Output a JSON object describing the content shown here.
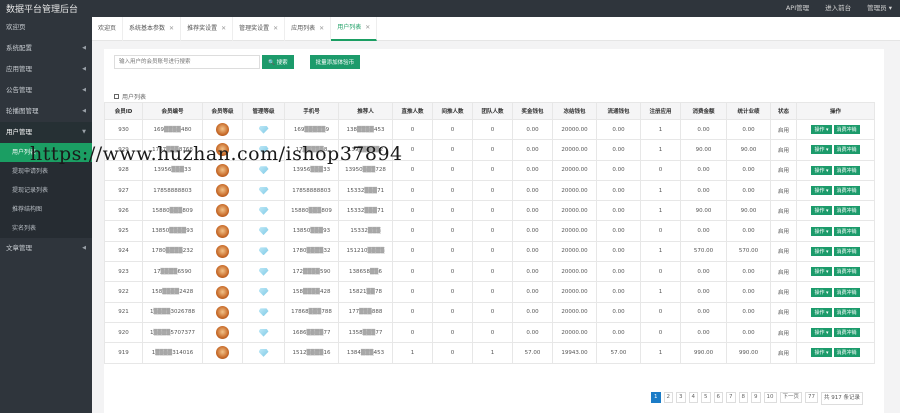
{
  "topbar": {
    "title": "数据平台管理后台",
    "nav": [
      "API管理",
      "进入前台",
      "管理员 ▾"
    ]
  },
  "sidebar": {
    "items": [
      {
        "label": "欢迎页",
        "arrow": ""
      },
      {
        "label": "系统配置",
        "arrow": "◀"
      },
      {
        "label": "应用管理",
        "arrow": "◀"
      },
      {
        "label": "公告管理",
        "arrow": "◀"
      },
      {
        "label": "轮播图管理",
        "arrow": "◀"
      },
      {
        "label": "用户管理",
        "arrow": "▼"
      }
    ],
    "sub_items": [
      "用户列表",
      "提现申请列表",
      "提现记录列表",
      "推荐结构图",
      "实名列表"
    ],
    "after_items": [
      {
        "label": "文章管理",
        "arrow": "◀"
      }
    ]
  },
  "tabs": [
    {
      "label": "欢迎页",
      "closable": false
    },
    {
      "label": "系统基本参数",
      "closable": true
    },
    {
      "label": "推荐奖设置",
      "closable": true
    },
    {
      "label": "管理奖设置",
      "closable": true
    },
    {
      "label": "应用列表",
      "closable": true
    },
    {
      "label": "用户列表",
      "closable": true
    }
  ],
  "search": {
    "placeholder": "输入用户的会员账号进行搜索",
    "button_label": "🔍 搜索",
    "batch_label": "批量添加体验币"
  },
  "list_title": "用户列表",
  "table": {
    "headers": [
      "会员ID",
      "会员编号",
      "会员等级",
      "管理等级",
      "手机号",
      "推荐人",
      "直推人数",
      "间推人数",
      "团队人数",
      "奖金钱包",
      "冻结钱包",
      "流通钱包",
      "注册应用",
      "消费金额",
      "统计业绩",
      "状态",
      "操作"
    ],
    "rows": [
      [
        "930",
        "169▒▒▒▒480",
        "",
        "",
        "169▒▒▒▒▒9",
        "138▒▒▒▒453",
        "0",
        "0",
        "0",
        "0.00",
        "20000.00",
        "0.00",
        "1",
        "0.00",
        "0.00",
        "启用"
      ],
      [
        "929",
        "1767▒▒▒8768",
        "",
        "",
        "17▒▒▒▒▒8",
        "139▒▒▒▒▒2",
        "0",
        "0",
        "0",
        "0.00",
        "20000.00",
        "0.00",
        "1",
        "90.00",
        "90.00",
        "启用"
      ],
      [
        "928",
        "13956▒▒▒33",
        "",
        "",
        "13956▒▒▒33",
        "13950▒▒▒728",
        "0",
        "0",
        "0",
        "0.00",
        "20000.00",
        "0.00",
        "0",
        "0.00",
        "0.00",
        "启用"
      ],
      [
        "927",
        "17858888803",
        "",
        "",
        "17858888803",
        "15332▒▒▒71",
        "0",
        "0",
        "0",
        "0.00",
        "20000.00",
        "0.00",
        "1",
        "0.00",
        "0.00",
        "启用"
      ],
      [
        "926",
        "15880▒▒▒809",
        "",
        "",
        "15880▒▒▒809",
        "15332▒▒▒71",
        "0",
        "0",
        "0",
        "0.00",
        "20000.00",
        "0.00",
        "1",
        "90.00",
        "90.00",
        "启用"
      ],
      [
        "925",
        "13850▒▒▒▒93",
        "",
        "",
        "13850▒▒▒93",
        "15332▒▒▒",
        "0",
        "0",
        "0",
        "0.00",
        "20000.00",
        "0.00",
        "0",
        "0.00",
        "0.00",
        "启用"
      ],
      [
        "924",
        "1780▒▒▒▒232",
        "",
        "",
        "1780▒▒▒▒32",
        "151210▒▒▒▒",
        "0",
        "0",
        "0",
        "0.00",
        "20000.00",
        "0.00",
        "1",
        "570.00",
        "570.00",
        "启用"
      ],
      [
        "923",
        "17▒▒▒▒6590",
        "",
        "",
        "172▒▒▒▒590",
        "138658▒▒6",
        "0",
        "0",
        "0",
        "0.00",
        "20000.00",
        "0.00",
        "0",
        "0.00",
        "0.00",
        "启用"
      ],
      [
        "922",
        "158▒▒▒▒2428",
        "",
        "",
        "158▒▒▒▒428",
        "15821▒▒78",
        "0",
        "0",
        "0",
        "0.00",
        "20000.00",
        "0.00",
        "1",
        "0.00",
        "0.00",
        "启用"
      ],
      [
        "921",
        "1▒▒▒▒3026788",
        "",
        "",
        "17868▒▒▒788",
        "177▒▒▒888",
        "0",
        "0",
        "0",
        "0.00",
        "20000.00",
        "0.00",
        "0",
        "0.00",
        "0.00",
        "启用"
      ],
      [
        "920",
        "1▒▒▒▒5707377",
        "",
        "",
        "1686▒▒▒▒77",
        "1358▒▒▒77",
        "0",
        "0",
        "0",
        "0.00",
        "20000.00",
        "0.00",
        "0",
        "0.00",
        "0.00",
        "启用"
      ],
      [
        "919",
        "1▒▒▒▒314016",
        "",
        "",
        "1512▒▒▒▒16",
        "1384▒▒▒453",
        "1",
        "0",
        "1",
        "57.00",
        "19943.00",
        "57.00",
        "1",
        "990.00",
        "990.00",
        "启用"
      ]
    ],
    "op_label": "操作 ▾",
    "op2_label": "消费冲销"
  },
  "pager": {
    "pages": [
      "1",
      "2",
      "3",
      "4",
      "5",
      "6",
      "7",
      "8",
      "9",
      "10"
    ],
    "active": "1",
    "next": "下一页",
    "last": "77",
    "total": "共 917 条记录"
  },
  "watermark": "https://www.huzhan.com/ishop37894",
  "colors": {
    "sidebar_bg": "#2f353c",
    "active_green": "#1b9e63",
    "button_green": "#1c9b6b",
    "pager_blue": "#1b7cc7"
  }
}
